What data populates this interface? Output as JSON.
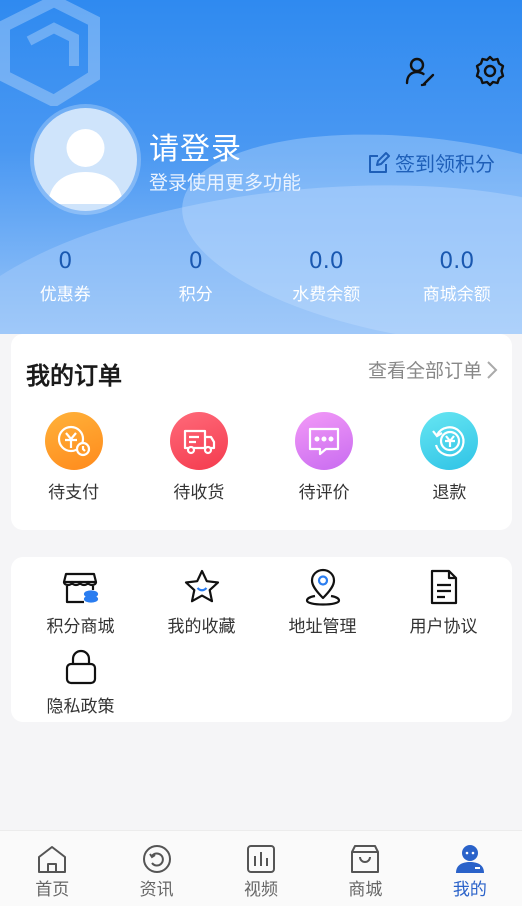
{
  "header": {
    "login_title": "请登录",
    "login_subtitle": "登录使用更多功能",
    "signin_label": "签到领积分",
    "user_edit_icon": "user-edit-icon",
    "settings_icon": "gear-icon"
  },
  "stats": [
    {
      "value": "0",
      "label": "优惠券"
    },
    {
      "value": "0",
      "label": "积分"
    },
    {
      "value": "0.0",
      "label": "水费余额"
    },
    {
      "value": "0.0",
      "label": "商城余额"
    }
  ],
  "orders": {
    "title": "我的订单",
    "view_all": "查看全部订单",
    "items": [
      {
        "label": "待支付",
        "icon": "payment-icon"
      },
      {
        "label": "待收货",
        "icon": "truck-icon"
      },
      {
        "label": "待评价",
        "icon": "comment-icon"
      },
      {
        "label": "退款",
        "icon": "refund-icon"
      }
    ]
  },
  "services": {
    "items": [
      {
        "label": "积分商城",
        "icon": "shop-icon"
      },
      {
        "label": "我的收藏",
        "icon": "star-icon"
      },
      {
        "label": "地址管理",
        "icon": "location-icon"
      },
      {
        "label": "用户协议",
        "icon": "document-icon"
      },
      {
        "label": "隐私政策",
        "icon": "lock-icon"
      }
    ]
  },
  "tabbar": {
    "items": [
      {
        "label": "首页",
        "icon": "home-icon"
      },
      {
        "label": "资讯",
        "icon": "news-icon"
      },
      {
        "label": "视频",
        "icon": "video-icon"
      },
      {
        "label": "商城",
        "icon": "shopping-bag-icon"
      },
      {
        "label": "我的",
        "icon": "profile-icon"
      }
    ],
    "active_index": 4
  },
  "colors": {
    "header_blue": "#2f8af0",
    "stat_value": "#1a58b0",
    "active_tab": "#2a62c9"
  }
}
